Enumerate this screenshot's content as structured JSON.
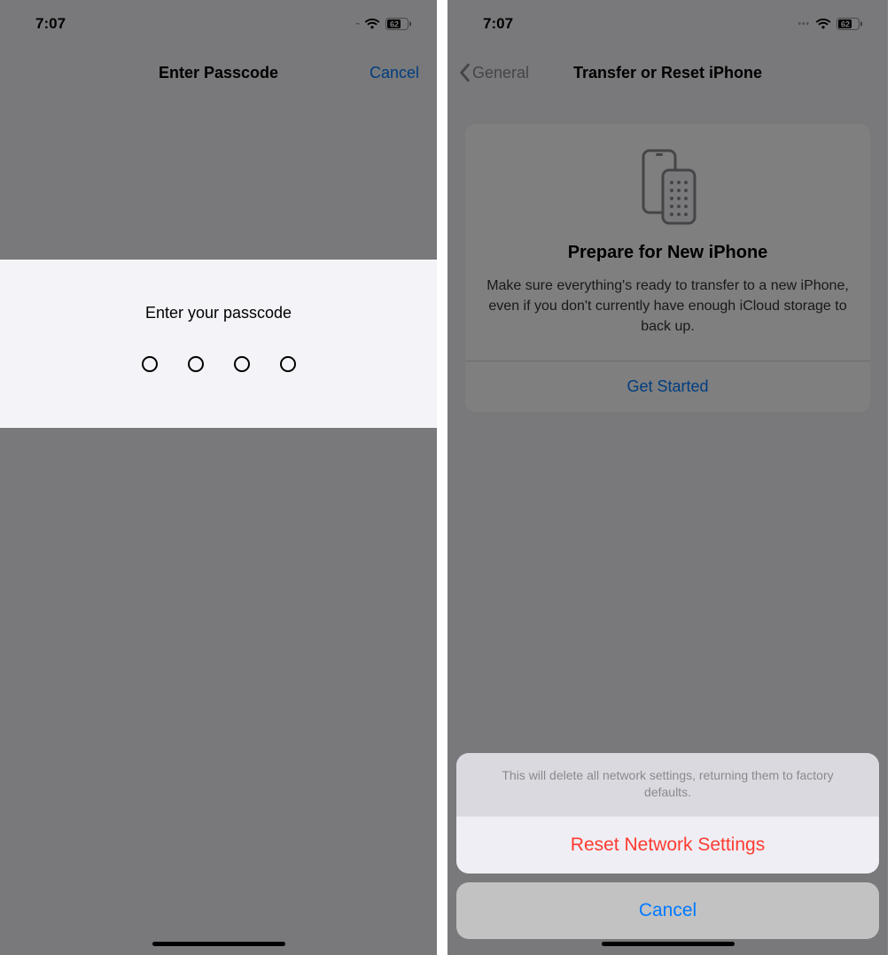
{
  "left": {
    "status": {
      "time": "7:07",
      "battery": "62"
    },
    "nav": {
      "title": "Enter Passcode",
      "right": "Cancel"
    },
    "passcode": {
      "label": "Enter your passcode",
      "digits": 4
    }
  },
  "right": {
    "status": {
      "time": "7:07",
      "battery": "62"
    },
    "nav": {
      "back": "General",
      "title": "Transfer or Reset iPhone"
    },
    "prepare": {
      "title": "Prepare for New iPhone",
      "desc": "Make sure everything's ready to transfer to a new iPhone, even if you don't currently have enough iCloud storage to back up.",
      "cta": "Get Started"
    },
    "sheet": {
      "message": "This will delete all network settings, returning them to factory defaults.",
      "action": "Reset Network Settings",
      "cancel": "Cancel"
    }
  }
}
